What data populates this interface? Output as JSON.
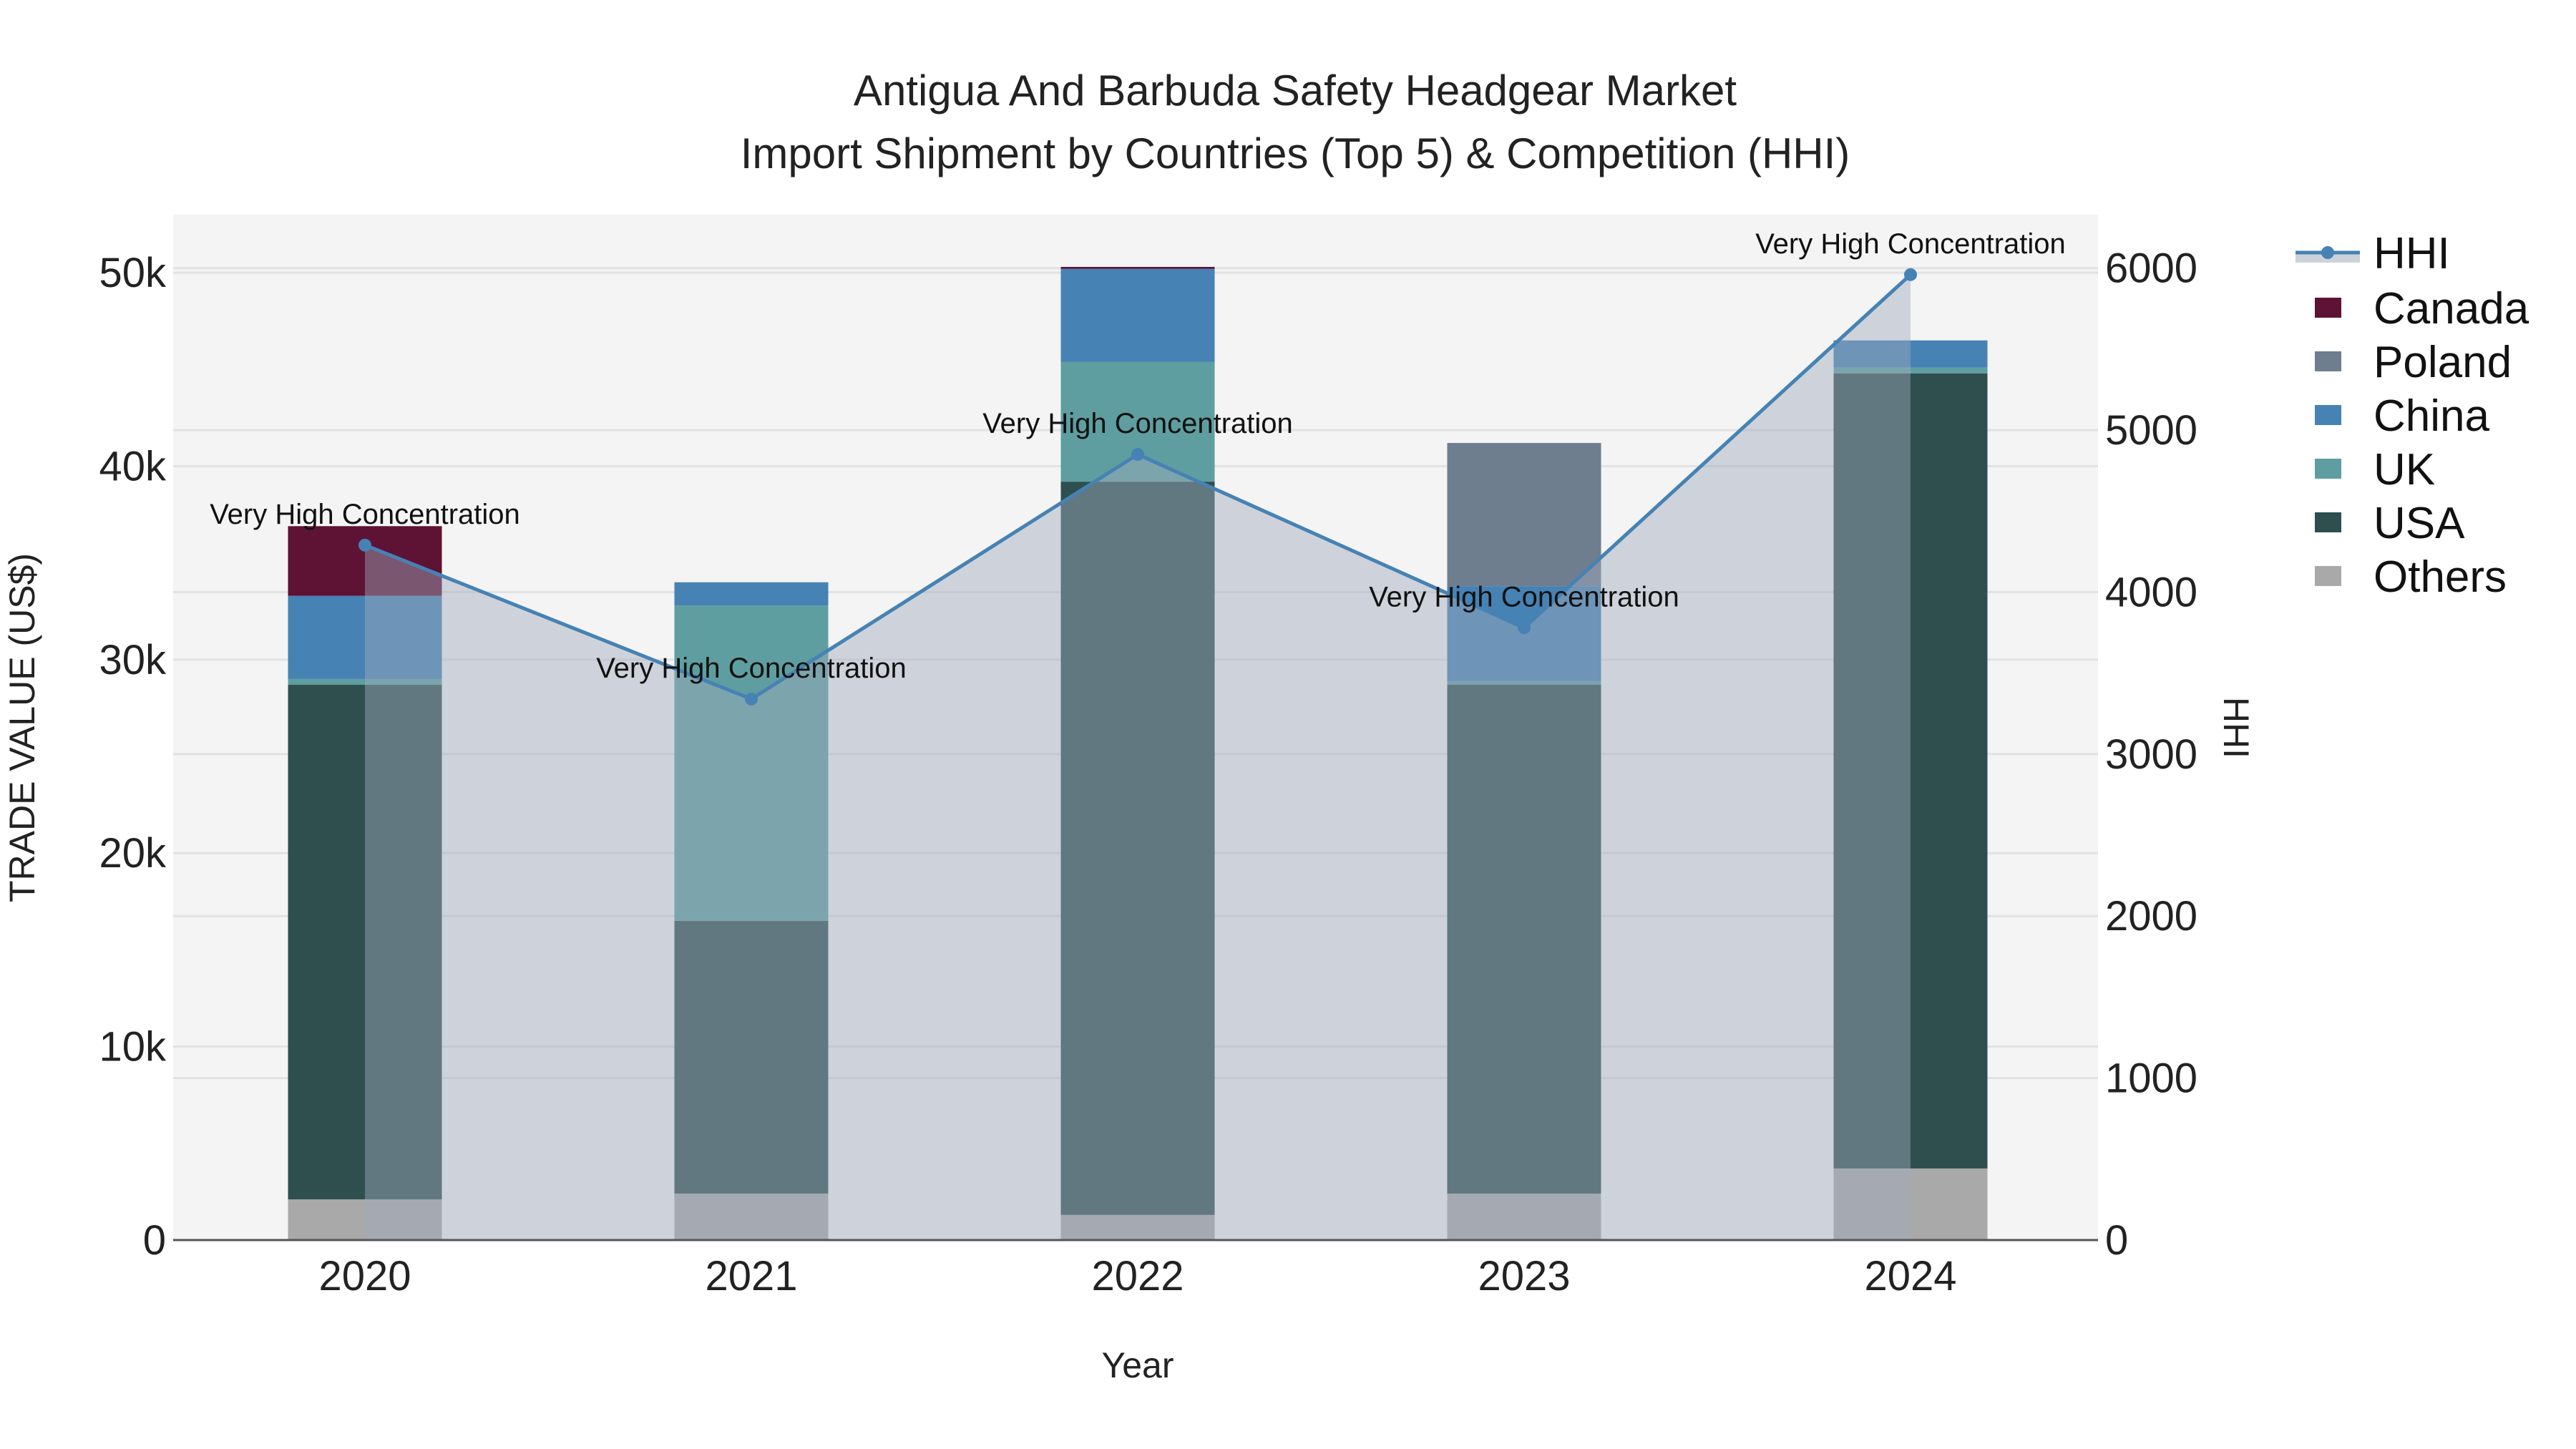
{
  "chart_data": {
    "type": "bar",
    "title": "Antigua And Barbuda Safety Headgear Market",
    "subtitle": "Import Shipment by Countries (Top 5) & Competition (HHI)",
    "xlabel": "Year",
    "ylabel": "TRADE VALUE (US$)",
    "y2label": "HHI",
    "categories": [
      "2020",
      "2021",
      "2022",
      "2023",
      "2024"
    ],
    "ylim": [
      0,
      53000
    ],
    "y2lim": [
      0,
      6330
    ],
    "yticks": [
      "0",
      "10k",
      "20k",
      "30k",
      "40k",
      "50k"
    ],
    "yticks_values": [
      0,
      10000,
      20000,
      30000,
      40000,
      50000
    ],
    "y2ticks": [
      "0",
      "1000",
      "2000",
      "3000",
      "4000",
      "5000",
      "6000"
    ],
    "y2ticks_values": [
      0,
      1000,
      2000,
      3000,
      4000,
      5000,
      6000
    ],
    "stack_order": [
      "Others",
      "USA",
      "UK",
      "China",
      "Poland",
      "Canada"
    ],
    "series": [
      {
        "name": "Canada",
        "color": "#5e1234",
        "values": [
          3600,
          0,
          100,
          0,
          0
        ]
      },
      {
        "name": "Poland",
        "color": "#6e7e8e",
        "values": [
          0,
          0,
          0,
          7400,
          0
        ]
      },
      {
        "name": "China",
        "color": "#4682b4",
        "values": [
          4300,
          1200,
          4800,
          4900,
          1400
        ]
      },
      {
        "name": "UK",
        "color": "#5f9ea0",
        "values": [
          300,
          16300,
          6200,
          200,
          300
        ]
      },
      {
        "name": "USA",
        "color": "#2f4f4f",
        "values": [
          26600,
          14100,
          37900,
          26300,
          41100
        ]
      },
      {
        "name": "Others",
        "color": "#a9a9a9",
        "values": [
          2100,
          2400,
          1300,
          2400,
          3700
        ]
      }
    ],
    "hhi": {
      "name": "HHI",
      "color": "#4682b4",
      "values": [
        4290,
        3340,
        4850,
        3780,
        5960
      ]
    },
    "annotations": [
      "Very High Concentration",
      "Very High Concentration",
      "Very High Concentration",
      "Very High Concentration",
      "Very High Concentration"
    ],
    "legend_position": "right",
    "grid": true
  }
}
